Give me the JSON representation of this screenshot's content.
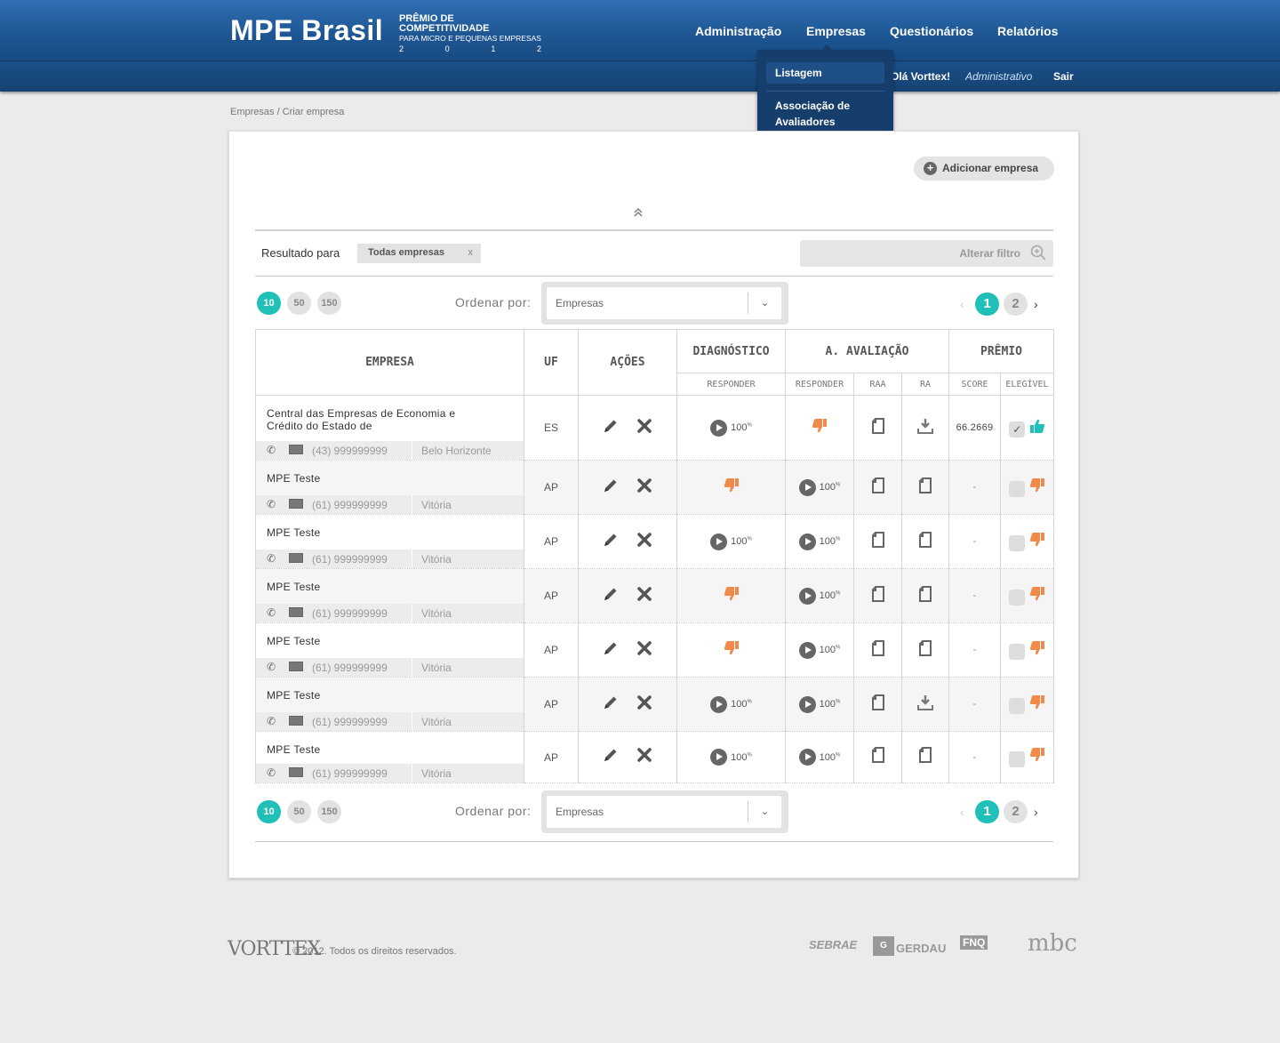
{
  "header": {
    "logo": "MPE Brasil",
    "award_line1": "PRÊMIO DE COMPETITIVIDADE",
    "award_line2": "PARA MICRO E PEQUENAS EMPRESAS",
    "year_digits": [
      "2",
      "0",
      "1",
      "2"
    ],
    "nav": [
      "Administração",
      "Empresas",
      "Questionários",
      "Relatórios"
    ],
    "dropdown": [
      "Listagem",
      "Associação de Avaliadores"
    ],
    "greeting": "Olá Vorttex!",
    "role": "Administrativo",
    "logout": "Sair"
  },
  "breadcrumb": "Empresas / Criar empresa",
  "add_button": "Adicionar empresa",
  "result_label": "Resultado para",
  "result_tag": "Todas empresas",
  "tag_close": "x",
  "filter_label": "Alterar filtro",
  "per_page": [
    "10",
    "50",
    "150"
  ],
  "order_label": "Ordenar por:",
  "order_value": "Empresas",
  "pages": [
    "1",
    "2"
  ],
  "columns": {
    "empresa": "EMPRESA",
    "uf": "UF",
    "acoes": "AÇÕES",
    "diagnostico": "DIAGNÓSTICO",
    "aval": "A. AVALIAÇÃO",
    "premio": "PRÊMIO",
    "responder1": "RESPONDER",
    "responder2": "RESPONDER",
    "raa": "RAA",
    "ra": "RA",
    "score": "SCORE",
    "elegivel": "ELEGÍVEL"
  },
  "rows": [
    {
      "name": "Central das Empresas de Economia e Crédito do Estado de",
      "phone": "(43) 999999999",
      "city": "Belo Horizonte",
      "uf": "ES",
      "diag": "100",
      "aval": "down",
      "raa": "doc",
      "ra": "download",
      "score": "66.2669",
      "eleg": "up"
    },
    {
      "name": "MPE Teste",
      "phone": "(61) 999999999",
      "city": "Vitória",
      "uf": "AP",
      "diag": "down",
      "aval": "100",
      "raa": "doc",
      "ra": "doc",
      "score": "-",
      "eleg": "down"
    },
    {
      "name": "MPE Teste",
      "phone": "(61) 999999999",
      "city": "Vitória",
      "uf": "AP",
      "diag": "100",
      "aval": "100",
      "raa": "doc",
      "ra": "doc",
      "score": "-",
      "eleg": "down"
    },
    {
      "name": "MPE Teste",
      "phone": "(61) 999999999",
      "city": "Vitória",
      "uf": "AP",
      "diag": "down",
      "aval": "100",
      "raa": "doc",
      "ra": "doc",
      "score": "-",
      "eleg": "down"
    },
    {
      "name": "MPE Teste",
      "phone": "(61) 999999999",
      "city": "Vitória",
      "uf": "AP",
      "diag": "down",
      "aval": "100",
      "raa": "doc",
      "ra": "doc",
      "score": "-",
      "eleg": "down"
    },
    {
      "name": "MPE Teste",
      "phone": "(61) 999999999",
      "city": "Vitória",
      "uf": "AP",
      "diag": "100",
      "aval": "100",
      "raa": "doc",
      "ra": "download",
      "score": "-",
      "eleg": "down"
    },
    {
      "name": "MPE Teste",
      "phone": "(61) 999999999",
      "city": "Vitória",
      "uf": "AP",
      "diag": "100",
      "aval": "100",
      "raa": "doc",
      "ra": "doc",
      "score": "-",
      "eleg": "down"
    }
  ],
  "percent_symbol": "%",
  "footer": {
    "brand": "VORTTEX",
    "copyright": "© 2012. Todos os direitos reservados.",
    "partners": [
      "SEBRAE",
      "GERDAU",
      "FNQ",
      "mbc"
    ]
  },
  "colors": {
    "accent": "#20bfb8",
    "header": "#1d5592",
    "thumb_down": "#f08a4b",
    "thumb_up": "#20bfb8"
  }
}
